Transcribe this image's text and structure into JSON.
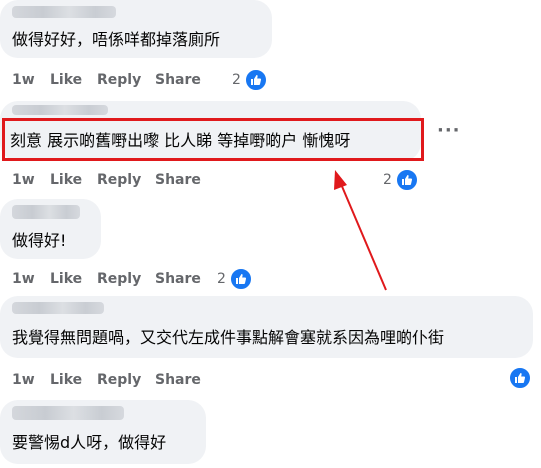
{
  "comments": [
    {
      "text": "做得好好，唔係咩都掉落廁所",
      "time": "1w",
      "like": "Like",
      "reply": "Reply",
      "share": "Share",
      "reactions": "2"
    },
    {
      "text": "刻意 展示啲舊嘢出嚟 比人睇 等掉嘢啲户 慚愧呀",
      "time": "1w",
      "like": "Like",
      "reply": "Reply",
      "share": "Share",
      "reactions": "2"
    },
    {
      "text": "做得好!",
      "time": "1w",
      "like": "Like",
      "reply": "Reply",
      "share": "Share",
      "reactions": "2"
    },
    {
      "text": "我覺得無問題喎，又交代左成件事點解會塞就系因為哩啲仆街",
      "time": "1w",
      "like": "Like",
      "reply": "Reply",
      "share": "Share",
      "reactions": ""
    },
    {
      "text": "要警惕d人呀，做得好"
    }
  ],
  "icons": {
    "reaction": "like-thumb-icon",
    "more": "more-options-icon"
  },
  "colors": {
    "bubble": "#f0f2f5",
    "highlight": "#e0191c",
    "like_blue": "#1877f2",
    "meta": "#65676b"
  }
}
